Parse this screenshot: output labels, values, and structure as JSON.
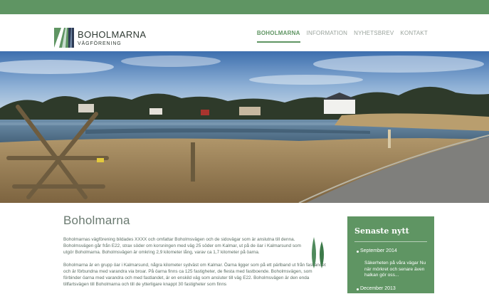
{
  "colors": {
    "brand_green": "#5f9563",
    "nav_inactive": "#9aa39c",
    "body_text": "#5c6e64"
  },
  "header": {
    "logo_name": "BOHOLMARNA",
    "logo_sub": "VÄGFÖRENING",
    "logo_icon": "road-logo-icon"
  },
  "nav": {
    "items": [
      {
        "label": "BOHOLMARNA",
        "active": true
      },
      {
        "label": "INFORMATION",
        "active": false
      },
      {
        "label": "NYHETSBREV",
        "active": false
      },
      {
        "label": "KONTAKT",
        "active": false
      }
    ]
  },
  "hero": {
    "icon": "lake-landscape-photo"
  },
  "main": {
    "title": "Boholmarna",
    "paragraphs": [
      "Boholmarnas vägförening bildades XXXX och omfattar Boholmsvägen och de sidovägar som är anslutna till denna. Boholmsvägen går från E22, strax söder om korsningen med väg 25 söder om Kalmar, ut på de öar i Kalmarsund som utgör Boholmarna. Boholmsvägen är omkring 2,9 kilometer lång, varav ca 1,7 kilometer på öarna.",
      "Boholmarna är en grupp öar i Kalmarsund, några kilometer sydväst om Kalmar. Öarna ligger som på ett pärlband ut från fastlandet och är förbundna med varandra via broar. På öarna finns ca 125 fastigheter, de flesta med fastboende. Boholmsvägen, som förbinder öarna med varandra och med fastlandet, är en enskild väg som ansluter till väg E22. Boholmsvägen är den enda tillfartsvägen till Boholmarna och till de ytterligare knappt 30 fastigheter som finns"
    ]
  },
  "sidebar": {
    "title": "Senaste nytt",
    "news": [
      {
        "date": "September 2014",
        "text": "Säkerheten på våra vägar Nu när mörkret och senare även halkan gör oss..."
      },
      {
        "date": "December 2013",
        "text": ""
      }
    ]
  }
}
